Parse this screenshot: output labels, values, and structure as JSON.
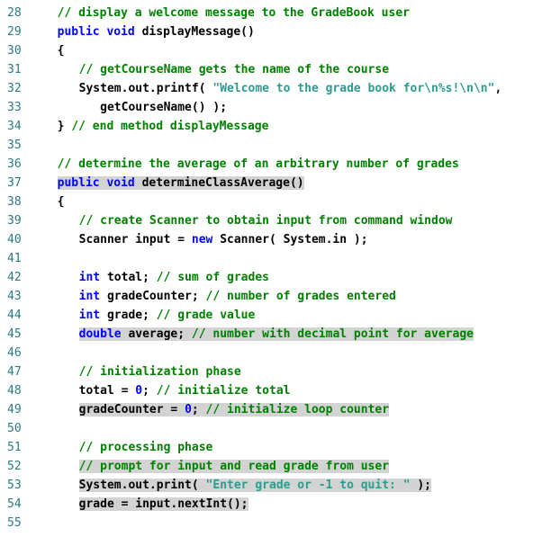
{
  "lines": {
    "l28": {
      "num": "28",
      "comment": "// display a welcome message to the GradeBook user"
    },
    "l29": {
      "num": "29",
      "kw1": "public",
      "kw2": "void",
      "id": " displayMessage()"
    },
    "l30": {
      "num": "30",
      "brace": "{"
    },
    "l31": {
      "num": "31",
      "comment": "// getCourseName gets the name of the course"
    },
    "l32": {
      "num": "32",
      "pre": "System.out.printf( ",
      "str": "\"Welcome to the grade book for\\n%s!\\n\\n\"",
      "post": ","
    },
    "l33": {
      "num": "33",
      "text": "   getCourseName() );"
    },
    "l34": {
      "num": "34",
      "brace": "} ",
      "comment": "// end method displayMessage"
    },
    "l35": {
      "num": "35"
    },
    "l36": {
      "num": "36",
      "comment": "// determine the average of an arbitrary number of grades"
    },
    "l37": {
      "num": "37",
      "kw1": "public",
      "kw2": " void",
      "id": " determineClassAverage()"
    },
    "l38": {
      "num": "38",
      "brace": "{"
    },
    "l39": {
      "num": "39",
      "comment": "// create Scanner to obtain input from command window"
    },
    "l40": {
      "num": "40",
      "pre": "Scanner input = ",
      "kw": "new",
      "post": " Scanner( System.in );"
    },
    "l41": {
      "num": "41"
    },
    "l42": {
      "num": "42",
      "kw": "int",
      "id": " total; ",
      "comment": "// sum of grades"
    },
    "l43": {
      "num": "43",
      "kw": "int",
      "id": " gradeCounter; ",
      "comment": "// number of grades entered"
    },
    "l44": {
      "num": "44",
      "kw": "int",
      "id": " grade; ",
      "comment": "// grade value"
    },
    "l45": {
      "num": "45",
      "kw": "double",
      "id": " average; ",
      "comment": "// number with decimal point for average"
    },
    "l46": {
      "num": "46"
    },
    "l47": {
      "num": "47",
      "comment": "// initialization phase"
    },
    "l48": {
      "num": "48",
      "pre": "total = ",
      "num2": "0",
      "post": "; ",
      "comment": "// initialize total"
    },
    "l49": {
      "num": "49",
      "pre": "gradeCounter = ",
      "num2": "0",
      "post": "; ",
      "comment": "// initialize loop counter"
    },
    "l50": {
      "num": "50"
    },
    "l51": {
      "num": "51",
      "comment": "// processing phase"
    },
    "l52": {
      "num": "52",
      "comment": "// prompt for input and read grade from user"
    },
    "l53": {
      "num": "53",
      "pre": "System.out.print( ",
      "str": "\"Enter grade or -1 to quit: \"",
      "post": " );"
    },
    "l54": {
      "num": "54",
      "text": "grade = input.nextInt();"
    },
    "l55": {
      "num": "55"
    }
  }
}
